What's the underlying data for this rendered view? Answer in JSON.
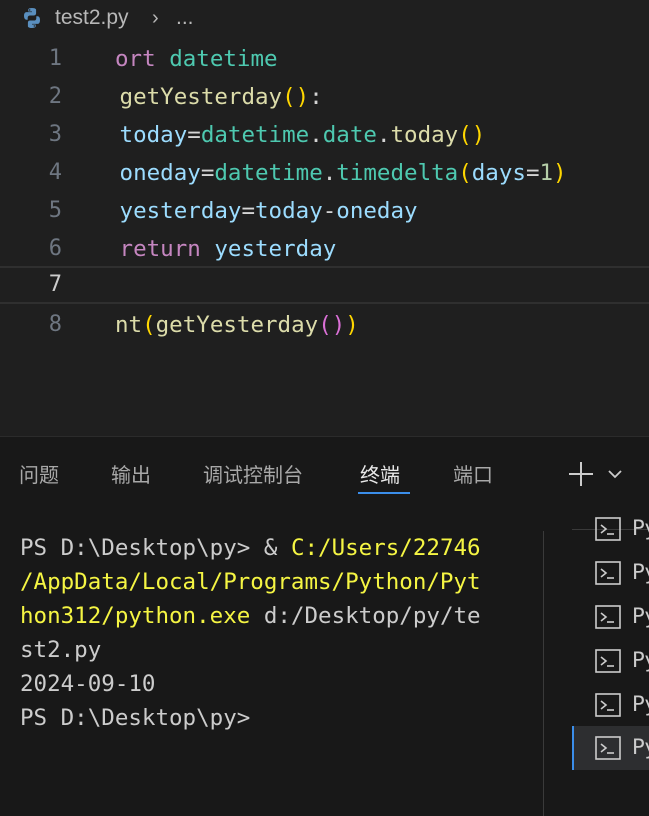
{
  "breadcrumb": {
    "file_icon": "python-icon",
    "file_name": "test2.py",
    "separator_icon": "chevron-right-icon",
    "more": "..."
  },
  "editor": {
    "current_line": 7,
    "lines": [
      {
        "number": "1",
        "text": "ort datetime"
      },
      {
        "number": "2",
        "text": " getYesterday():"
      },
      {
        "number": "3",
        "text": " today=datetime.date.today()"
      },
      {
        "number": "4",
        "text": " oneday=datetime.timedelta(days=1)"
      },
      {
        "number": "5",
        "text": " yesterday=today-oneday"
      },
      {
        "number": "6",
        "text": " return yesterday"
      },
      {
        "number": "7",
        "text": ""
      },
      {
        "number": "8",
        "text": "nt(getYesterday())"
      }
    ]
  },
  "panel": {
    "tabs": [
      {
        "label": "问题"
      },
      {
        "label": "输出"
      },
      {
        "label": "调试控制台"
      },
      {
        "label": "终端",
        "active": true
      },
      {
        "label": "端口"
      }
    ],
    "actions": {
      "new_terminal_icon": "plus-icon",
      "dropdown_icon": "chevron-down-icon"
    }
  },
  "terminal": {
    "lines": [
      {
        "prefix": "PS D:\\Desktop\\py> & ",
        "highlight": "C:/Users/22746"
      },
      {
        "prefix": "",
        "highlight": "/AppData/Local/Programs/Python/Pyt"
      },
      {
        "prefix": "",
        "highlight": "hon312/python.exe",
        "suffix": " d:/Desktop/py/te"
      },
      {
        "prefix": "st2.py"
      },
      {
        "prefix": "2024-09-10"
      },
      {
        "prefix": "PS D:\\Desktop\\py>"
      }
    ],
    "instances": [
      {
        "label": "Py",
        "icon": "terminal-icon"
      },
      {
        "label": "Py",
        "icon": "terminal-icon"
      },
      {
        "label": "Py",
        "icon": "terminal-icon"
      },
      {
        "label": "Py",
        "icon": "terminal-icon"
      },
      {
        "label": "Py",
        "icon": "terminal-icon"
      },
      {
        "label": "Py",
        "icon": "terminal-icon",
        "active": true
      }
    ]
  },
  "colors": {
    "editor_background": "#1f1f1f",
    "panel_background": "#181818",
    "accent": "#3b8eea",
    "path_highlight": "#f5f543",
    "keyword": "#c586c0",
    "module": "#4ec9b0",
    "function": "#dcdcaa",
    "variable": "#9cdcfe",
    "number": "#b5cea8",
    "bracket_1": "#ffd700",
    "bracket_2": "#da70d6"
  }
}
